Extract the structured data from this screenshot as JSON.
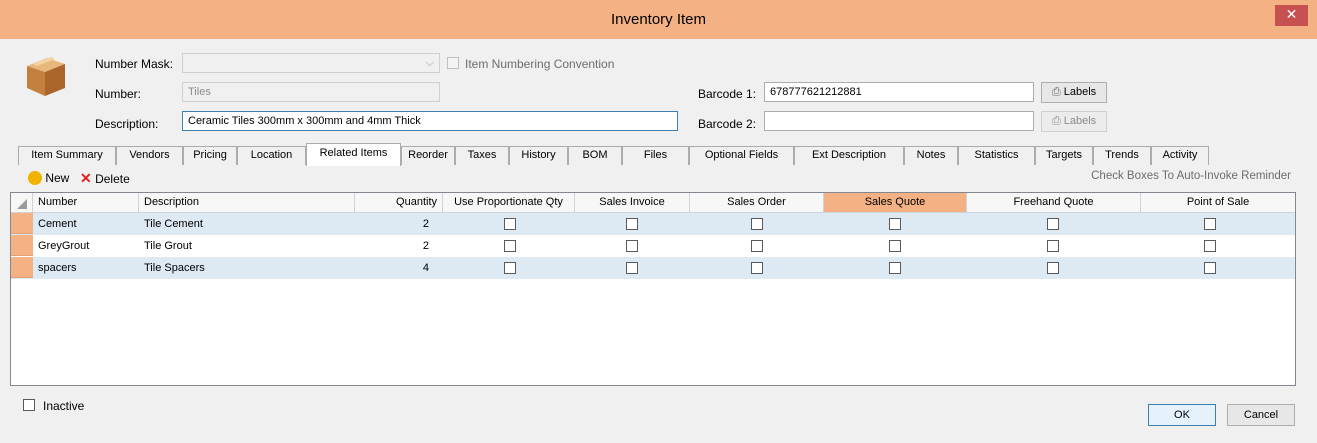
{
  "window": {
    "title": "Inventory Item",
    "close_glyph": "✕"
  },
  "header": {
    "number_mask_label": "Number Mask:",
    "number_mask_value": "",
    "item_numbering_label": "Item Numbering Convention",
    "number_label": "Number:",
    "number_value": "Tiles",
    "description_label": "Description:",
    "description_value": "Ceramic Tiles 300mm x 300mm and 4mm Thick",
    "barcode1_label": "Barcode 1:",
    "barcode1_value": "678777621212881",
    "barcode2_label": "Barcode 2:",
    "barcode2_value": "",
    "labels_button": "Labels"
  },
  "tabs": [
    "Item Summary",
    "Vendors",
    "Pricing",
    "Location",
    "Related Items",
    "Reorder",
    "Taxes",
    "History",
    "BOM",
    "Files",
    "Optional Fields",
    "Ext Description",
    "Notes",
    "Statistics",
    "Targets",
    "Trends",
    "Activity"
  ],
  "active_tab": "Related Items",
  "toolbar": {
    "new_label": "New",
    "delete_label": "Delete",
    "hint": "Check Boxes To Auto-Invoke Reminder"
  },
  "grid": {
    "columns": [
      "Number",
      "Description",
      "Quantity",
      "Use Proportionate Qty",
      "Sales Invoice",
      "Sales Order",
      "Sales Quote",
      "Freehand Quote",
      "Point of Sale"
    ],
    "rows": [
      {
        "number": "Cement",
        "description": "Tile Cement",
        "quantity": "2"
      },
      {
        "number": "GreyGrout",
        "description": "Tile Grout",
        "quantity": "2"
      },
      {
        "number": "spacers",
        "description": "Tile Spacers",
        "quantity": "4"
      }
    ]
  },
  "footer": {
    "inactive_label": "Inactive",
    "ok_label": "OK",
    "cancel_label": "Cancel"
  },
  "colors": {
    "accent": "#f4b183",
    "selection_row": "#dde9f3"
  }
}
